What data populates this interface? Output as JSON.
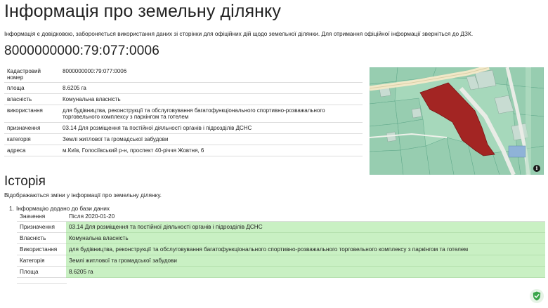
{
  "page": {
    "title": "Інформація про земельну ділянку",
    "notice": "Інформація є довідковою, забороняється використання даних зі сторінки для офіційних дій щодо земельної ділянки. Для отримання офіційної інформації зверніться до ДЗК.",
    "cadastral_heading": "8000000000:79:077:0006"
  },
  "properties": [
    {
      "label": "Кадастровий номер",
      "value": "8000000000:79:077:0006"
    },
    {
      "label": "площа",
      "value": "8.6205 га"
    },
    {
      "label": "власність",
      "value": "Комунальна власність"
    },
    {
      "label": "використання",
      "value": "для будівництва, реконструкції та обслуговування багатофункціонального спортивно-розважального торговельного комплексу з паркінгом та готелем"
    },
    {
      "label": "призначення",
      "value": "03.14 Для розміщення та постійної діяльності органів і підрозділів ДСНС"
    },
    {
      "label": "категорія",
      "value": "Землі житлової та громадської забудови"
    },
    {
      "label": "адреса",
      "value": "м.Київ, Голосіївський р-н, проспект 40-річчя Жовтня, 6"
    }
  ],
  "map": {
    "info_icon": "info-icon",
    "parcel_color": "#a32523",
    "background_color": "#9fd2b6"
  },
  "history": {
    "title": "Історія",
    "description": "Відображаються зміни у інформації про земельну ділянку.",
    "items": [
      {
        "number": "1.",
        "heading": "Інформацію додано до бази даних",
        "col_field": "Значення",
        "col_after": "Після 2020-01-20",
        "rows": [
          {
            "label": "Призначення",
            "value": "03.14 Для розміщення та постійної діяльності органів і підрозділів ДСНС"
          },
          {
            "label": "Власність",
            "value": "Комунальна власність"
          },
          {
            "label": "Використання",
            "value": "для будівництва, реконструкції та обслуговування багатофункціонального спортивно-розважального торговельного комплексу з паркінгом та готелем"
          },
          {
            "label": "Категорія",
            "value": "Землі житлової та громадської забудови"
          },
          {
            "label": "Площа",
            "value": "8.6205 га"
          }
        ]
      }
    ]
  },
  "colors": {
    "changed_row": "#c9f0c3",
    "shield": "#3aa64a"
  },
  "badge_icon": "shield-check-icon"
}
